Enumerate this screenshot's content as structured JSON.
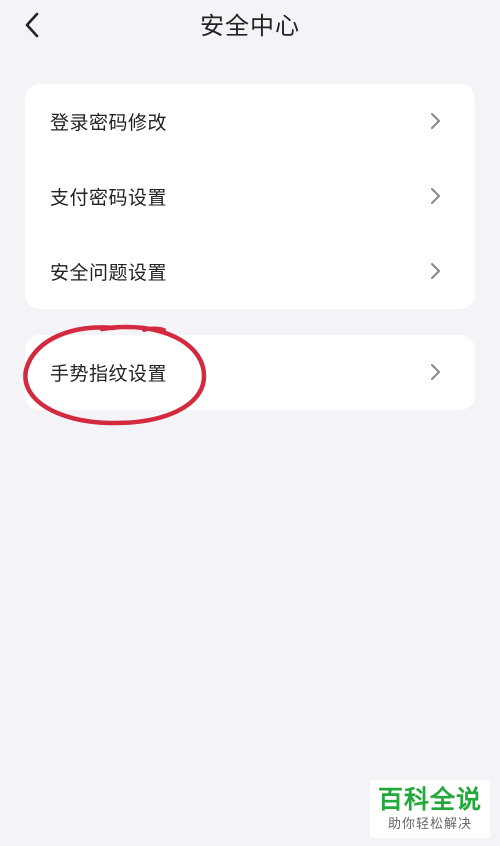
{
  "header": {
    "title": "安全中心",
    "back_icon": "chevron-left-icon"
  },
  "security_group": {
    "items": [
      {
        "label": "登录密码修改",
        "icon": "chevron-right-icon"
      },
      {
        "label": "支付密码设置",
        "icon": "chevron-right-icon"
      },
      {
        "label": "安全问题设置",
        "icon": "chevron-right-icon"
      }
    ]
  },
  "gesture_group": {
    "items": [
      {
        "label": "手势指纹设置",
        "icon": "chevron-right-icon"
      }
    ]
  },
  "annotation": {
    "shape": "hand-drawn-ellipse",
    "color": "#d42a3f"
  },
  "watermark": {
    "main": "百科全说",
    "sub": "助你轻松解决",
    "color": "#22a93a"
  },
  "colors": {
    "background": "#f4f3f7",
    "card": "#ffffff",
    "text": "#222222",
    "chevron": "#888888"
  }
}
